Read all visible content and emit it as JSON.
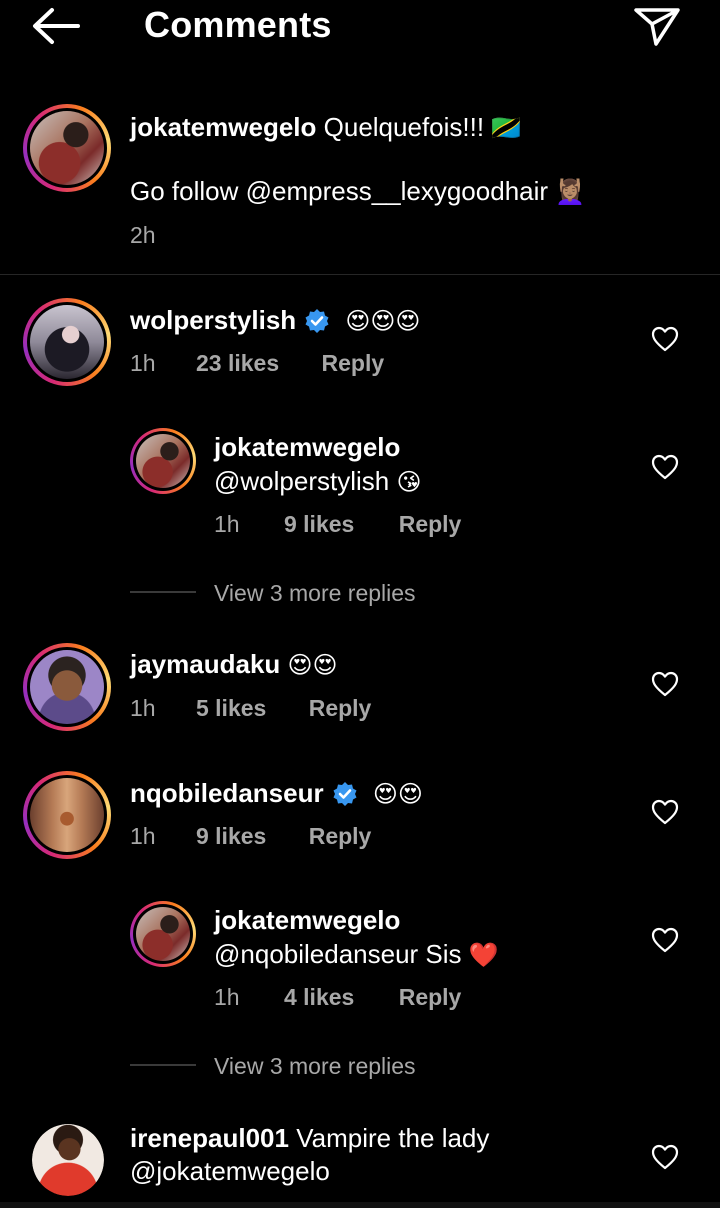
{
  "header": {
    "title": "Comments"
  },
  "caption": {
    "username": "jokatemwegelo",
    "text_line1": "Quelquefois!!!",
    "text_line1_emoji": "🇹🇿",
    "text_line2": "Go follow @empress__lexygoodhair",
    "text_line2_emoji": "💆🏽‍♀️",
    "time": "2h"
  },
  "comments": [
    {
      "username": "wolperstylish",
      "verified": true,
      "text": "😍😍😍",
      "time": "1h",
      "likes": "23 likes",
      "reply": "Reply",
      "replies": [
        {
          "username": "jokatemwegelo",
          "text": "@wolperstylish",
          "emoji": "😘",
          "time": "1h",
          "likes": "9 likes",
          "reply": "Reply"
        }
      ],
      "view_more": "View 3 more replies"
    },
    {
      "username": "jaymaudaku",
      "verified": false,
      "text": "😍😍",
      "time": "1h",
      "likes": "5 likes",
      "reply": "Reply"
    },
    {
      "username": "nqobiledanseur",
      "verified": true,
      "text": "😍😍",
      "time": "1h",
      "likes": "9 likes",
      "reply": "Reply",
      "replies": [
        {
          "username": "jokatemwegelo",
          "text": "@nqobiledanseur Sis",
          "emoji": "❤️",
          "time": "1h",
          "likes": "4 likes",
          "reply": "Reply"
        }
      ],
      "view_more": "View 3 more replies"
    },
    {
      "username": "irenepaul001",
      "verified": false,
      "text": "Vampire the lady",
      "text_line2": "@jokatemwegelo"
    }
  ],
  "colors": {
    "background": "#000000",
    "secondary_text": "#a8a8a8",
    "verified": "#3897f0",
    "heart_red": "#ed4956"
  }
}
